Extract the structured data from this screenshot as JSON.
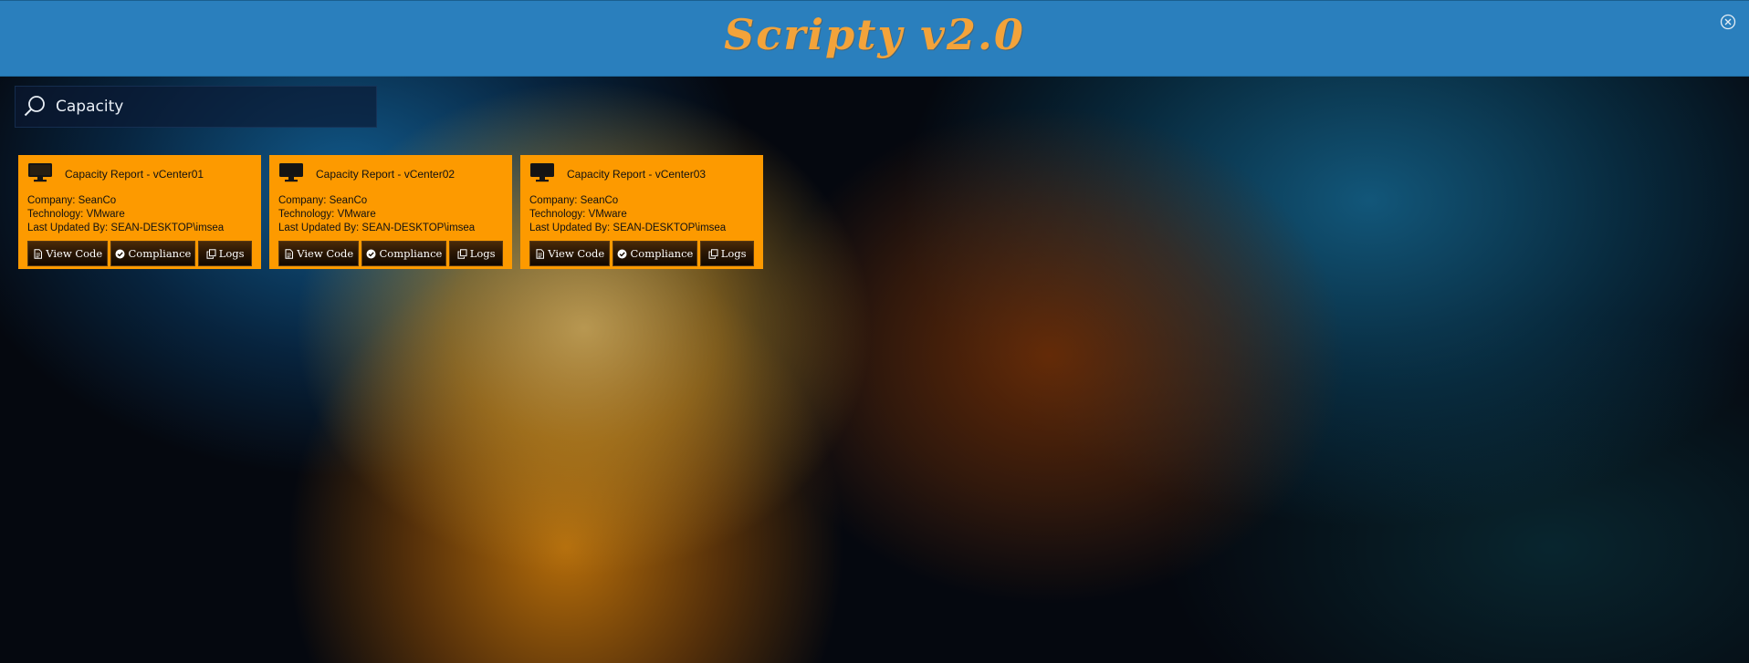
{
  "app": {
    "title": "Scripty v2.0"
  },
  "search": {
    "value": "Capacity",
    "placeholder": ""
  },
  "labels": {
    "company_prefix": "Company: ",
    "technology_prefix": "Technology: ",
    "updated_prefix": "Last Updated By: "
  },
  "cards": [
    {
      "title": "Capacity Report - vCenter01",
      "company": "SeanCo",
      "technology": "VMware",
      "updated_by": "SEAN-DESKTOP\\imsea",
      "buttons": {
        "view_code": "View Code",
        "compliance": "Compliance",
        "logs": "Logs"
      }
    },
    {
      "title": "Capacity Report - vCenter02",
      "company": "SeanCo",
      "technology": "VMware",
      "updated_by": "SEAN-DESKTOP\\imsea",
      "buttons": {
        "view_code": "View Code",
        "compliance": "Compliance",
        "logs": "Logs"
      }
    },
    {
      "title": "Capacity Report - vCenter03",
      "company": "SeanCo",
      "technology": "VMware",
      "updated_by": "SEAN-DESKTOP\\imsea",
      "buttons": {
        "view_code": "View Code",
        "compliance": "Compliance",
        "logs": "Logs"
      }
    }
  ],
  "icons": {
    "close": "close-circle-icon",
    "search": "search-icon",
    "card": "monitor-icon",
    "view_code": "document-icon",
    "compliance": "check-circle-icon",
    "logs": "copy-icon"
  },
  "colors": {
    "header": "#2a7fbd",
    "title": "#f3a33a",
    "card": "#fd9a00",
    "button": "#2b1704"
  }
}
